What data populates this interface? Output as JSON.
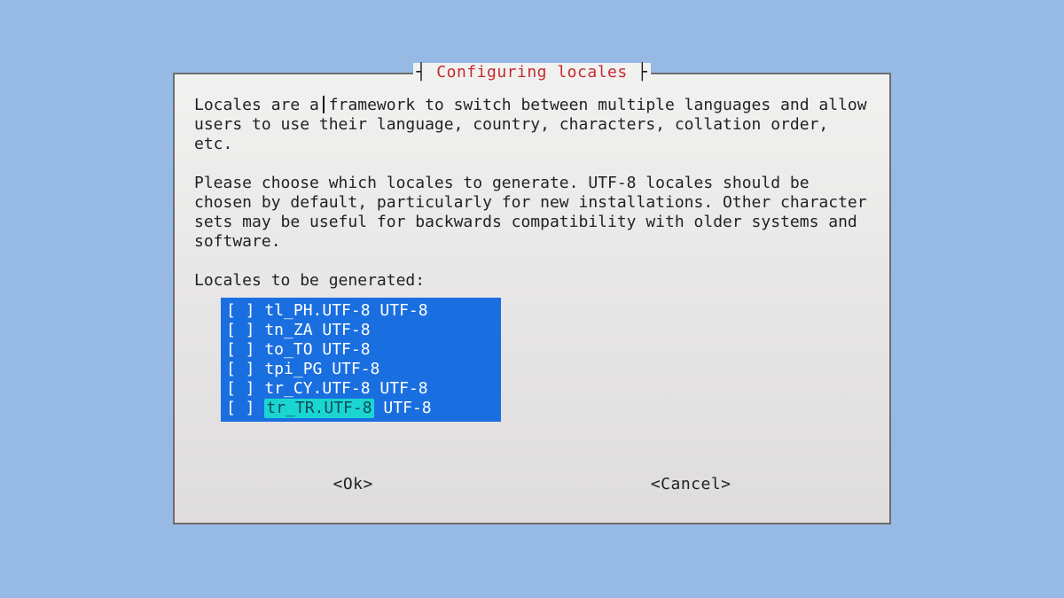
{
  "dialog": {
    "title": "Configuring locales",
    "paragraph1": "Locales are a framework to switch between multiple languages and allow users to use their language, country, characters, collation order, etc.",
    "paragraph2": "Please choose which locales to generate. UTF-8 locales should be chosen by default, particularly for new installations. Other character sets may be useful for backwards compatibility with older systems and software.",
    "list_label": "Locales to be generated:"
  },
  "locales": [
    {
      "checked": false,
      "label": "tl_PH.UTF-8 UTF-8",
      "highlighted": false
    },
    {
      "checked": false,
      "label": "tn_ZA UTF-8",
      "highlighted": false
    },
    {
      "checked": false,
      "label": "to_TO UTF-8",
      "highlighted": false
    },
    {
      "checked": false,
      "label": "tpi_PG UTF-8",
      "highlighted": false
    },
    {
      "checked": false,
      "label": "tr_CY.UTF-8 UTF-8",
      "highlighted": false
    },
    {
      "checked": false,
      "label": "tr_TR.UTF-8",
      "highlighted": true,
      "suffix": " UTF-8"
    }
  ],
  "buttons": {
    "ok": "<Ok>",
    "cancel": "<Cancel>"
  }
}
